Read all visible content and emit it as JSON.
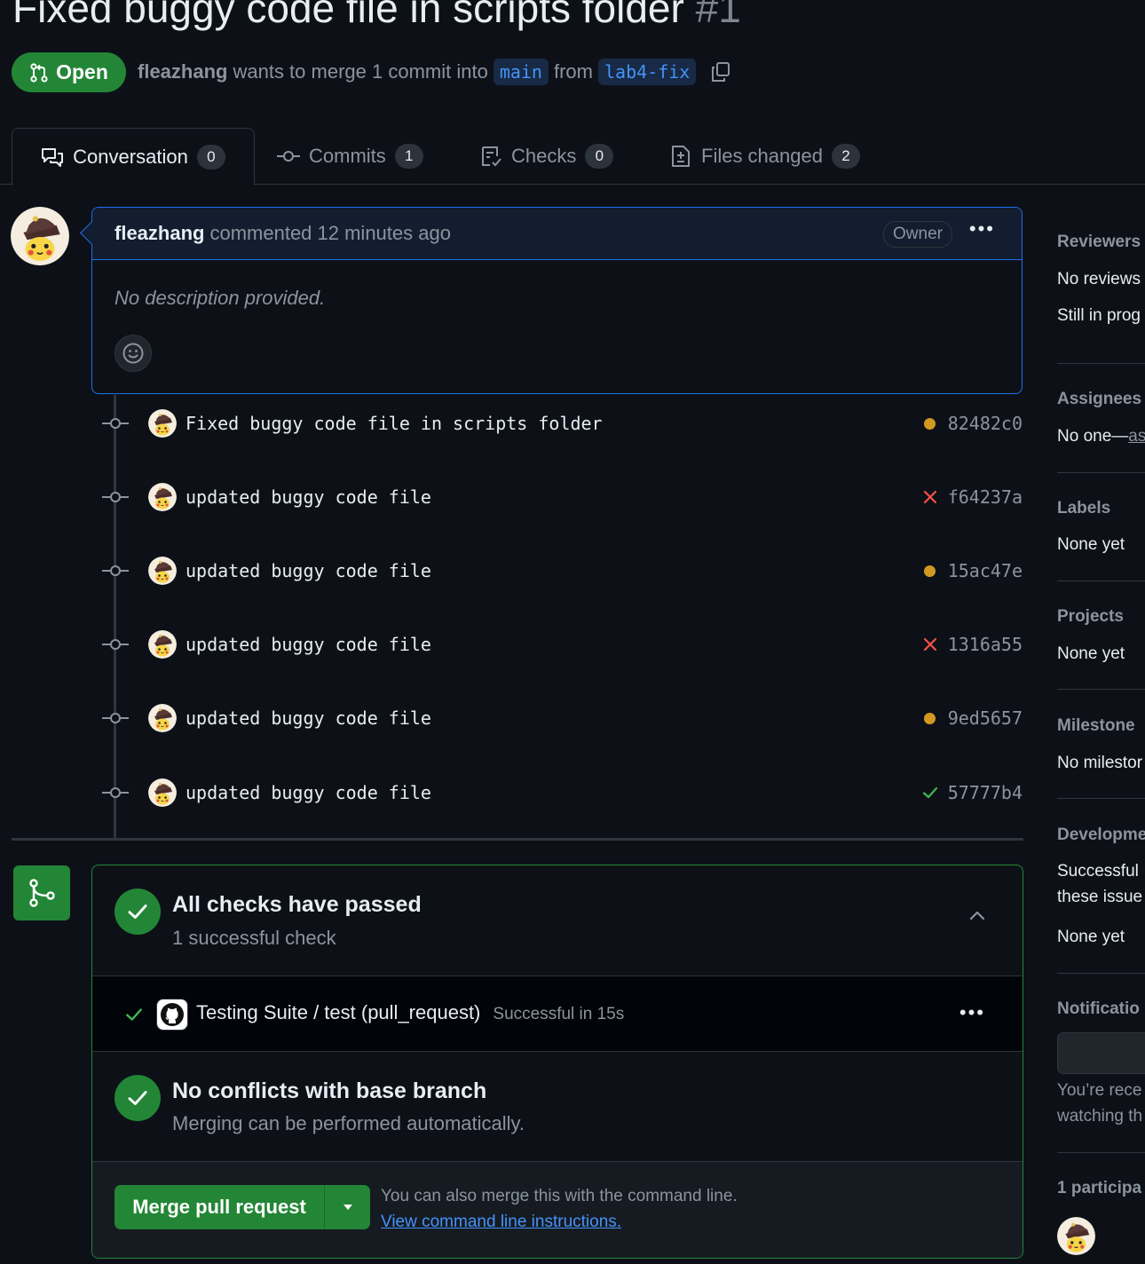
{
  "pr": {
    "title": "Fixed buggy code file in scripts folder",
    "number": "#1",
    "state": "Open",
    "author": "fleazhang",
    "merge_text": "wants to merge 1 commit into",
    "base_branch": "main",
    "from_text": "from",
    "head_branch": "lab4-fix"
  },
  "tabs": [
    {
      "label": "Conversation",
      "count": "0"
    },
    {
      "label": "Commits",
      "count": "1"
    },
    {
      "label": "Checks",
      "count": "0"
    },
    {
      "label": "Files changed",
      "count": "2"
    }
  ],
  "comment": {
    "author": "fleazhang",
    "meta": "commented 12 minutes ago",
    "role": "Owner",
    "body": "No description provided."
  },
  "commits": [
    {
      "message": "Fixed buggy code file in scripts folder",
      "status": "pending",
      "sha": "82482c0"
    },
    {
      "message": "updated buggy code file",
      "status": "failed",
      "sha": "f64237a"
    },
    {
      "message": "updated buggy code file",
      "status": "pending",
      "sha": "15ac47e"
    },
    {
      "message": "updated buggy code file",
      "status": "failed",
      "sha": "1316a55"
    },
    {
      "message": "updated buggy code file",
      "status": "pending",
      "sha": "9ed5657"
    },
    {
      "message": "updated buggy code file",
      "status": "success",
      "sha": "57777b4"
    }
  ],
  "merge_box": {
    "checks_title": "All checks have passed",
    "checks_sub": "1 successful check",
    "check_name": "Testing Suite / test (pull_request)",
    "check_result": "Successful in 15s",
    "conflicts_title": "No conflicts with base branch",
    "conflicts_sub": "Merging can be performed automatically.",
    "merge_button": "Merge pull request",
    "cli_text": "You can also merge this with the command line.",
    "cli_link": "View command line instructions."
  },
  "sidebar": {
    "reviewers_h": "Reviewers",
    "reviewers_v1": "No reviews",
    "reviewers_v2": "Still in prog",
    "assignees_h": "Assignees",
    "assignees_v": "No one—",
    "assignees_link": "as",
    "labels_h": "Labels",
    "labels_v": "None yet",
    "projects_h": "Projects",
    "projects_v": "None yet",
    "milestone_h": "Milestone",
    "milestone_v": "No milestor",
    "development_h": "Developme",
    "development_v1": "Successful",
    "development_v2": "these issue",
    "development_v3": "None yet",
    "notifications_h": "Notificatio",
    "notifications_v1": "You’re rece",
    "notifications_v2": "watching th",
    "participants_h": "1 participa"
  },
  "colors": {
    "background": "#0d1117",
    "success": "#238636",
    "pending": "#d29922",
    "failed": "#f85149",
    "link": "#4493f8",
    "border": "#30363d"
  }
}
